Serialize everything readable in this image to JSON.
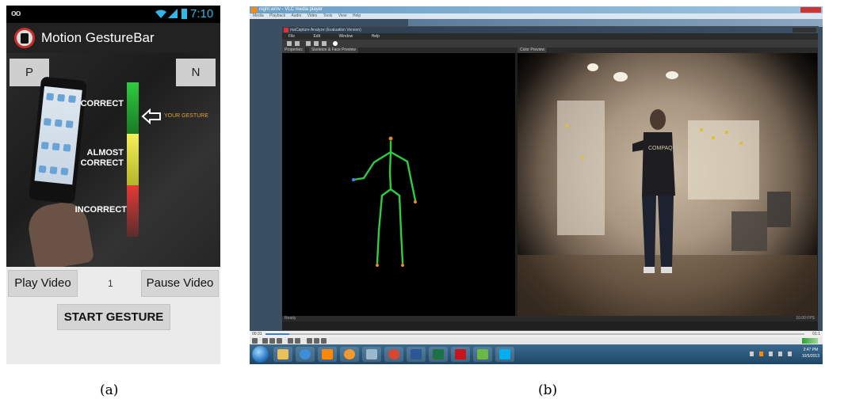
{
  "panel_a": {
    "status_bar": {
      "time": "7:10",
      "voicemail": "oo"
    },
    "app_title": "Motion GestureBar",
    "prev_button": "P",
    "next_button": "N",
    "meter": {
      "correct_label": "CORRECT",
      "almost_label_1": "ALMOST",
      "almost_label_2": "CORRECT",
      "incorrect_label": "INCORRECT",
      "indicator_label": "YOUR GESTURE",
      "indicator_level": "correct",
      "colors": {
        "correct": "#2ecc40",
        "almost": "#f5f05a",
        "incorrect": "#e53935",
        "indicator": "#e0a030"
      }
    },
    "play_button": "Play Video",
    "counter": "1",
    "pause_button": "Pause Video",
    "start_button": "START GESTURE",
    "caption": "(a)"
  },
  "panel_b": {
    "vlc": {
      "title": "night.wmv - VLC media player",
      "menu": [
        "Media",
        "Playback",
        "Audio",
        "Video",
        "Tools",
        "View",
        "Help"
      ],
      "elapsed": "00:31",
      "remaining": "01:1",
      "volume_percent": 100
    },
    "mocap": {
      "title": "maCapture Analyze (Evaluation Version)",
      "menu": [
        "File",
        "Edit",
        "Window",
        "Help"
      ],
      "tab_properties": "Properties",
      "tab_skeleton": "Skeleton & Face Preview",
      "tab_color": "Color Preview",
      "status": "Ready",
      "fps": "10.00 FPS",
      "shirt_text": "COMPAQ"
    },
    "taskbar": {
      "clock_time": "2:47 PM",
      "clock_date": "10/5/2013",
      "apps": [
        "explorer-icon",
        "ie-icon",
        "vlc-icon",
        "media-icon",
        "notes-icon",
        "chrome-icon",
        "word-icon",
        "excel-icon",
        "acrobat-icon",
        "misc-icon",
        "skype-icon"
      ]
    },
    "caption": "(b)"
  }
}
